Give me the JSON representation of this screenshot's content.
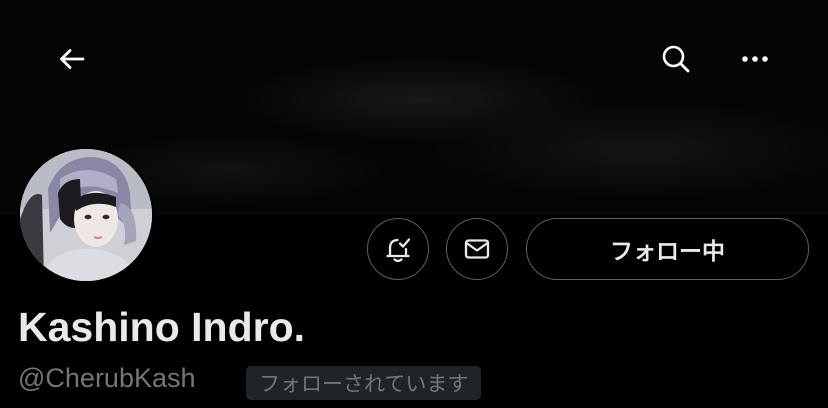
{
  "header": {
    "back_icon": "arrow-left-icon",
    "search_icon": "search-icon",
    "more_icon": "more-horizontal-icon"
  },
  "profile": {
    "display_name": "Kashino Indro.",
    "handle": "@CherubKash",
    "follows_you_badge": "フォローされています",
    "avatar_icon": "profile-photo"
  },
  "actions": {
    "notifications_icon": "bell-check-icon",
    "message_icon": "envelope-icon",
    "following_label": "フォロー中"
  },
  "colors": {
    "background": "#000000",
    "primary_text": "#e7e9ea",
    "secondary_text": "#71767b",
    "button_border": "#5a6167",
    "badge_background": "#202327"
  }
}
